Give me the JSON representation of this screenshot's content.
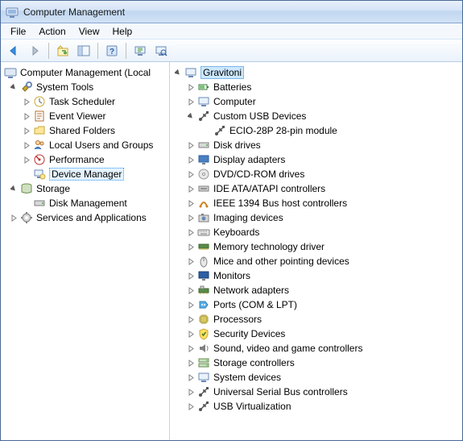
{
  "window": {
    "title": "Computer Management"
  },
  "menu": {
    "file": "File",
    "action": "Action",
    "view": "View",
    "help": "Help"
  },
  "left_tree": {
    "root": "Computer Management (Local",
    "system_tools": "System Tools",
    "task_scheduler": "Task Scheduler",
    "event_viewer": "Event Viewer",
    "shared_folders": "Shared Folders",
    "local_users": "Local Users and Groups",
    "performance": "Performance",
    "device_manager": "Device Manager",
    "storage": "Storage",
    "disk_management": "Disk Management",
    "services_apps": "Services and Applications"
  },
  "right_tree": {
    "root": "Gravitoni",
    "batteries": "Batteries",
    "computer": "Computer",
    "custom_usb": "Custom USB Devices",
    "ecio": "ECIO-28P 28-pin module",
    "disk_drives": "Disk drives",
    "display_adapters": "Display adapters",
    "dvd": "DVD/CD-ROM drives",
    "ide": "IDE ATA/ATAPI controllers",
    "ieee1394": "IEEE 1394 Bus host controllers",
    "imaging": "Imaging devices",
    "keyboards": "Keyboards",
    "memtech": "Memory technology driver",
    "mice": "Mice and other pointing devices",
    "monitors": "Monitors",
    "network": "Network adapters",
    "ports": "Ports (COM & LPT)",
    "processors": "Processors",
    "security": "Security Devices",
    "sound": "Sound, video and game controllers",
    "storage_ctrl": "Storage controllers",
    "system_devices": "System devices",
    "usb_ctrl": "Universal Serial Bus controllers",
    "usb_virt": "USB Virtualization"
  }
}
